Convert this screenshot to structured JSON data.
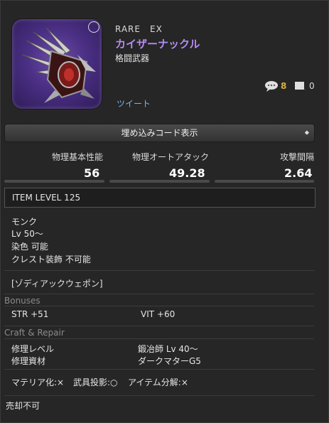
{
  "item": {
    "rarity": "RARE　EX",
    "name": "カイザーナックル",
    "category": "格闘武器",
    "comment_count": "8",
    "bookmark_count": "0",
    "tweet_label": "ツイート"
  },
  "embed_button_label": "埋め込みコード表示",
  "stats": [
    {
      "label": "物理基本性能",
      "value": "56"
    },
    {
      "label": "物理オートアタック",
      "value": "49.28"
    },
    {
      "label": "攻撃間隔",
      "value": "2.64"
    }
  ],
  "item_level": "ITEM LEVEL 125",
  "requirements": {
    "job": "モンク",
    "level": "Lv 50～",
    "dye": "染色 可能",
    "crest": "クレスト装飾 不可能"
  },
  "series": "[ゾディアックウェポン]",
  "bonuses": {
    "title": "Bonuses",
    "items": [
      "STR +51",
      "VIT +60"
    ]
  },
  "craft_repair": {
    "title": "Craft & Repair",
    "repair_level_label": "修理レベル",
    "repair_level_value": "鍛冶師 Lv 40～",
    "repair_material_label": "修理資材",
    "repair_material_value": "ダークマターG5"
  },
  "flags": {
    "materia": "マテリア化:×",
    "glamour": "武具投影:○",
    "desynth": "アイテム分解:×"
  },
  "sell": "売却不可",
  "colors": {
    "name": "#b48cf2",
    "link": "#7fb3e8",
    "comment_count": "#d8b040",
    "background": "#262626"
  },
  "icons": {
    "item": "kaiser-knuckle-claw-icon",
    "comment": "speech-bubble-icon",
    "bookmark": "bookmark-icon",
    "embed": "expand-arrows-icon"
  }
}
